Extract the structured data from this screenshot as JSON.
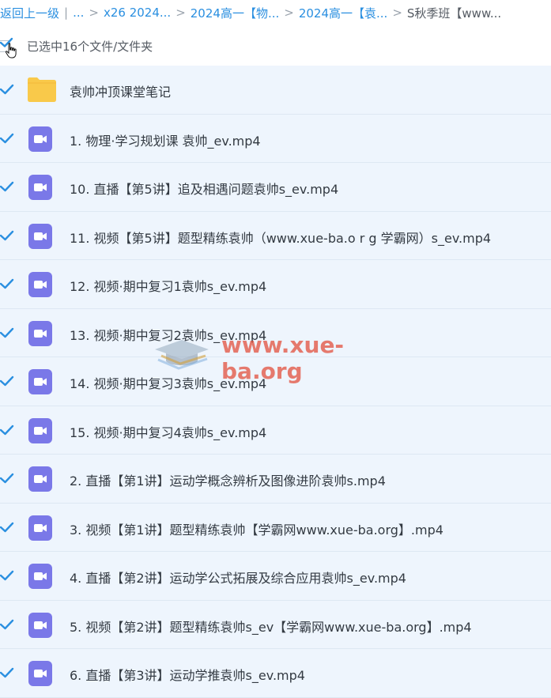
{
  "breadcrumb": {
    "items": [
      "返回上一级",
      "...",
      "x26 2024...",
      "2024高一【物...",
      "2024高一【袁...",
      "S秋季班【www..."
    ]
  },
  "selection": {
    "label": "已选中16个文件/文件夹"
  },
  "colors": {
    "accent": "#2a8fe0",
    "row_bg": "#eef5fd",
    "video_icon": "#7a78e8",
    "folder": "#f9c94a"
  },
  "files": [
    {
      "name": "袁帅冲顶课堂笔记",
      "type": "folder"
    },
    {
      "name": "1. 物理·学习规划课 袁帅_ev.mp4",
      "type": "video"
    },
    {
      "name": "10. 直播【第5讲】追及相遇问题袁帅s_ev.mp4",
      "type": "video"
    },
    {
      "name": "11. 视频【第5讲】题型精练袁帅（www.xue-ba.o r g 学霸网）s_ev.mp4",
      "type": "video"
    },
    {
      "name": "12. 视频·期中复习1袁帅s_ev.mp4",
      "type": "video"
    },
    {
      "name": "13. 视频·期中复习2袁帅s_ev.mp4",
      "type": "video"
    },
    {
      "name": "14. 视频·期中复习3袁帅s_ev.mp4",
      "type": "video"
    },
    {
      "name": "15. 视频·期中复习4袁帅s_ev.mp4",
      "type": "video"
    },
    {
      "name": "2. 直播【第1讲】运动学概念辨析及图像进阶袁帅s.mp4",
      "type": "video"
    },
    {
      "name": "3. 视频【第1讲】题型精练袁帅【学霸网www.xue-ba.org】.mp4",
      "type": "video"
    },
    {
      "name": "4. 直播【第2讲】运动学公式拓展及综合应用袁帅s_ev.mp4",
      "type": "video"
    },
    {
      "name": "5. 视频【第2讲】题型精练袁帅s_ev【学霸网www.xue-ba.org】.mp4",
      "type": "video"
    },
    {
      "name": "6. 直播【第3讲】运动学推袁帅s_ev.mp4",
      "type": "video"
    }
  ],
  "watermark": {
    "text": "www.xue-ba.org"
  }
}
